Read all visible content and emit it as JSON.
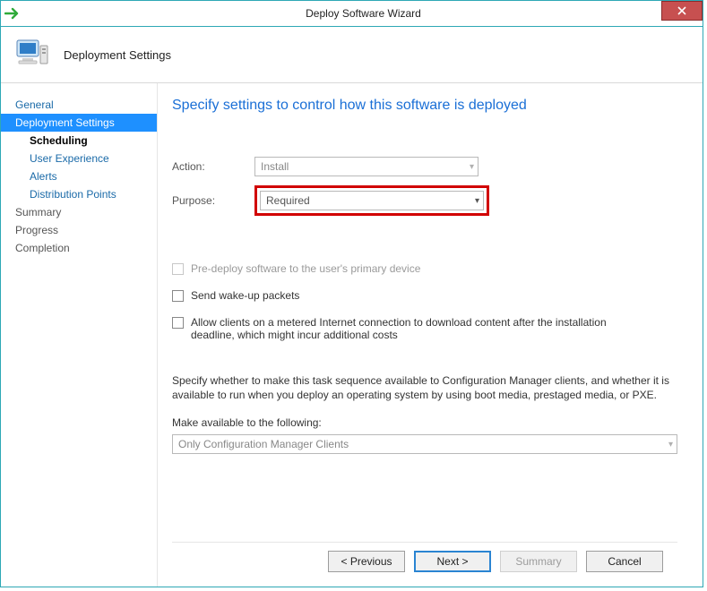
{
  "window": {
    "title": "Deploy Software Wizard"
  },
  "header": {
    "page_title": "Deployment Settings"
  },
  "sidebar": {
    "items": [
      {
        "label": "General"
      },
      {
        "label": "Deployment Settings"
      },
      {
        "label": "Scheduling"
      },
      {
        "label": "User Experience"
      },
      {
        "label": "Alerts"
      },
      {
        "label": "Distribution Points"
      },
      {
        "label": "Summary"
      },
      {
        "label": "Progress"
      },
      {
        "label": "Completion"
      }
    ]
  },
  "main": {
    "heading": "Specify settings to control how this software is deployed",
    "action": {
      "label": "Action:",
      "value": "Install"
    },
    "purpose": {
      "label": "Purpose:",
      "value": "Required"
    },
    "checks": {
      "predeploy": "Pre-deploy software to the user's primary device",
      "wakeup": "Send wake-up packets",
      "metered": "Allow clients on a metered Internet connection to download content after the installation deadline, which might incur additional costs"
    },
    "availability_note": "Specify whether to make this task sequence available to Configuration Manager clients, and whether it is available to run when you deploy an operating system by using boot media, prestaged media, or PXE.",
    "make_available_label": "Make available to the following:",
    "make_available_value": "Only Configuration Manager Clients"
  },
  "footer": {
    "previous": "< Previous",
    "next": "Next >",
    "summary": "Summary",
    "cancel": "Cancel"
  }
}
